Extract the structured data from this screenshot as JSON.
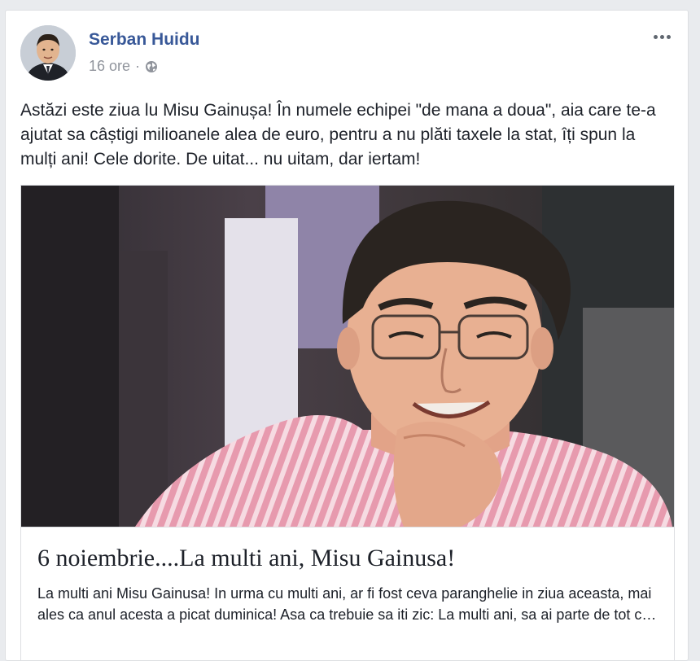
{
  "post": {
    "author": "Serban Huidu",
    "time": "16 ore",
    "separator": "·",
    "privacy_icon": "globe-icon",
    "more_icon": "more-options-icon",
    "text": "Astăzi este ziua lu Misu Gainușa! În numele echipei \"de mana a doua\", aia care te-a ajutat sa câștigi milioanele alea de euro, pentru a nu plăti taxele la stat, îți spun la mulți ani! Cele dorite. De uitat... nu uitam, dar iertam!"
  },
  "link_card": {
    "title": "6 noiembrie....La multi ani, Misu Gainusa!",
    "description": "La multi ani Misu Gainusa! In urma cu multi ani, ar fi fost ceva paranghelie in ziua aceasta, mai ales ca anul acesta a picat duminica! Asa ca trebuie sa iti zic: La multi ani, sa ai parte de tot c…"
  },
  "colors": {
    "author_link": "#385898",
    "meta_gray": "#90949c",
    "text": "#1d2129",
    "page_bg": "#e9ebee",
    "shirt": "#d98ea0"
  }
}
